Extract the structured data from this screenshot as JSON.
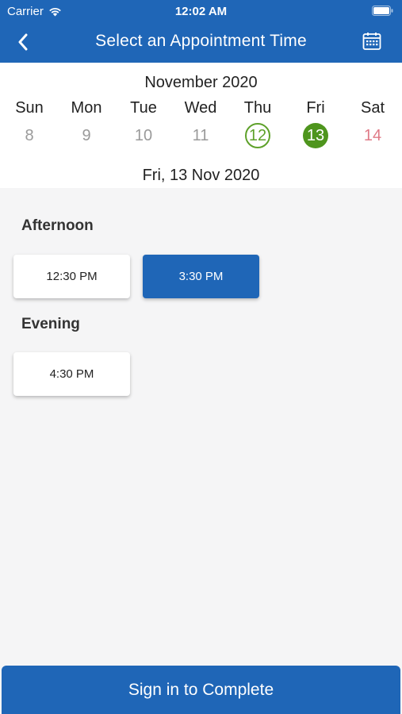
{
  "status_bar": {
    "carrier": "Carrier",
    "time": "12:02 AM"
  },
  "nav": {
    "title": "Select an Appointment Time"
  },
  "calendar": {
    "month": "November 2020",
    "weekdays": [
      "Sun",
      "Mon",
      "Tue",
      "Wed",
      "Thu",
      "Fri",
      "Sat"
    ],
    "days": [
      "8",
      "9",
      "10",
      "11",
      "12",
      "13",
      "14"
    ],
    "today_index": 4,
    "selected_index": 5,
    "selected_date_label": "Fri, 13 Nov 2020"
  },
  "sections": [
    {
      "title": "Afternoon",
      "slots": [
        "12:30 PM",
        "3:30 PM"
      ]
    },
    {
      "title": "Evening",
      "slots": [
        "4:30 PM"
      ]
    }
  ],
  "selected_slot": "3:30 PM",
  "cta_label": "Sign in to Complete",
  "colors": {
    "primary": "#1f66b7",
    "today": "#5ea12a",
    "selected_day": "#4e951d",
    "weekend": "#e07a87"
  }
}
